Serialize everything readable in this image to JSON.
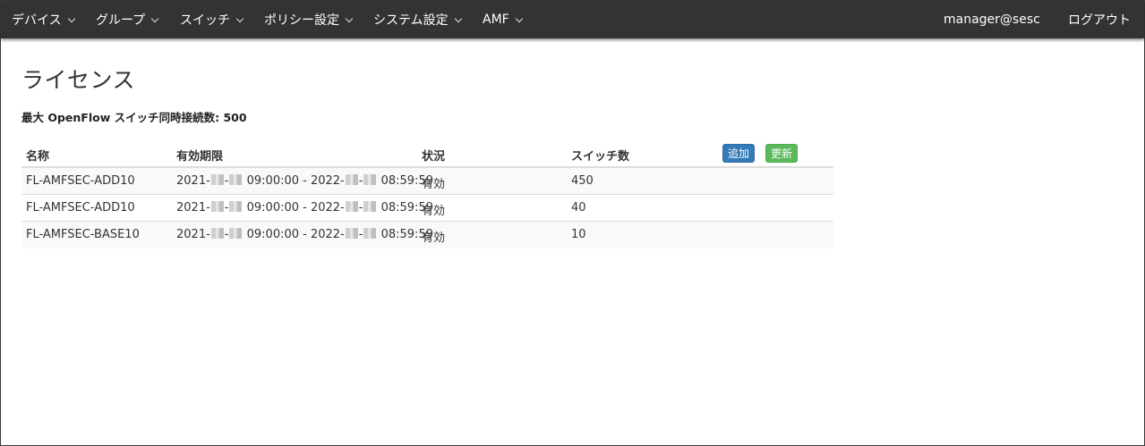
{
  "nav": {
    "items": [
      {
        "label": "デバイス"
      },
      {
        "label": "グループ"
      },
      {
        "label": "スイッチ"
      },
      {
        "label": "ポリシー設定"
      },
      {
        "label": "システム設定"
      },
      {
        "label": "AMF"
      }
    ],
    "user": "manager@sesc",
    "logout": "ログアウト"
  },
  "page": {
    "title": "ライセンス",
    "max_connections": "最大 OpenFlow スイッチ同時接続数: 500"
  },
  "table": {
    "headers": {
      "name": "名称",
      "period": "有効期限",
      "status": "状況",
      "switches": "スイッチ数"
    },
    "add_label": "追加",
    "update_label": "更新",
    "rows": [
      {
        "name": "FL-AMFSEC-ADD10",
        "start_year": "2021-",
        "start_time": "09:00:00 - 2022-",
        "end_time": "08:59:59",
        "status": "有効",
        "switches": "450"
      },
      {
        "name": "FL-AMFSEC-ADD10",
        "start_year": "2021-",
        "start_time": "09:00:00 - 2022-",
        "end_time": "08:59:59",
        "status": "有効",
        "switches": "40"
      },
      {
        "name": "FL-AMFSEC-BASE10",
        "start_year": "2021-",
        "start_time": "09:00:00 - 2022-",
        "end_time": "08:59:59",
        "status": "有効",
        "switches": "10"
      }
    ]
  },
  "colors": {
    "navbar": "#333333",
    "add_button": "#337ab7",
    "update_button": "#5cb85c"
  }
}
